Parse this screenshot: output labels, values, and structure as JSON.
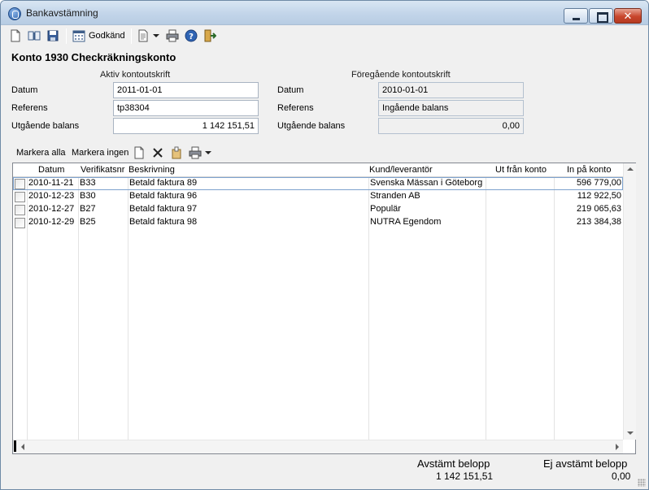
{
  "window": {
    "title": "Bankavstämning"
  },
  "toolbar": {
    "approve_label": "Godkänd"
  },
  "heading": "Konto 1930 Checkräkningskonto",
  "active_statement": {
    "title": "Aktiv kontoutskrift",
    "date_label": "Datum",
    "date_value": "2011-01-01",
    "ref_label": "Referens",
    "ref_value": "tp38304",
    "balance_label": "Utgående balans",
    "balance_value": "1 142 151,51"
  },
  "previous_statement": {
    "title": "Föregående kontoutskrift",
    "date_label": "Datum",
    "date_value": "2010-01-01",
    "ref_label": "Referens",
    "ref_value": "Ingående balans",
    "balance_label": "Utgående balans",
    "balance_value": "0,00"
  },
  "subtoolbar": {
    "select_all": "Markera alla",
    "select_none": "Markera ingen"
  },
  "grid": {
    "columns": [
      "Datum",
      "Verifikatsnr",
      "Beskrivning",
      "Kund/leverantör",
      "Ut från konto",
      "In på konto"
    ],
    "rows": [
      {
        "date": "2010-11-21",
        "ver": "B33",
        "desc": "Betald faktura 89",
        "party": "Svenska Mässan i Göteborg",
        "out": "",
        "in": "596 779,00"
      },
      {
        "date": "2010-12-23",
        "ver": "B30",
        "desc": "Betald faktura 96",
        "party": "Stranden AB",
        "out": "",
        "in": "112 922,50"
      },
      {
        "date": "2010-12-27",
        "ver": "B27",
        "desc": "Betald faktura 97",
        "party": "Populär",
        "out": "",
        "in": "219 065,63"
      },
      {
        "date": "2010-12-29",
        "ver": "B25",
        "desc": "Betald faktura 98",
        "party": "NUTRA Egendom",
        "out": "",
        "in": "213 384,38"
      }
    ]
  },
  "summary": {
    "reconciled_label": "Avstämt belopp",
    "reconciled_value": "1 142 151,51",
    "unreconciled_label": "Ej avstämt belopp",
    "unreconciled_value": "0,00"
  },
  "icons": [
    "new-document-icon",
    "open-book-icon",
    "save-icon",
    "calendar-icon",
    "page-icon",
    "print-icon",
    "help-icon",
    "exit-icon",
    "delete-icon",
    "attach-icon"
  ]
}
